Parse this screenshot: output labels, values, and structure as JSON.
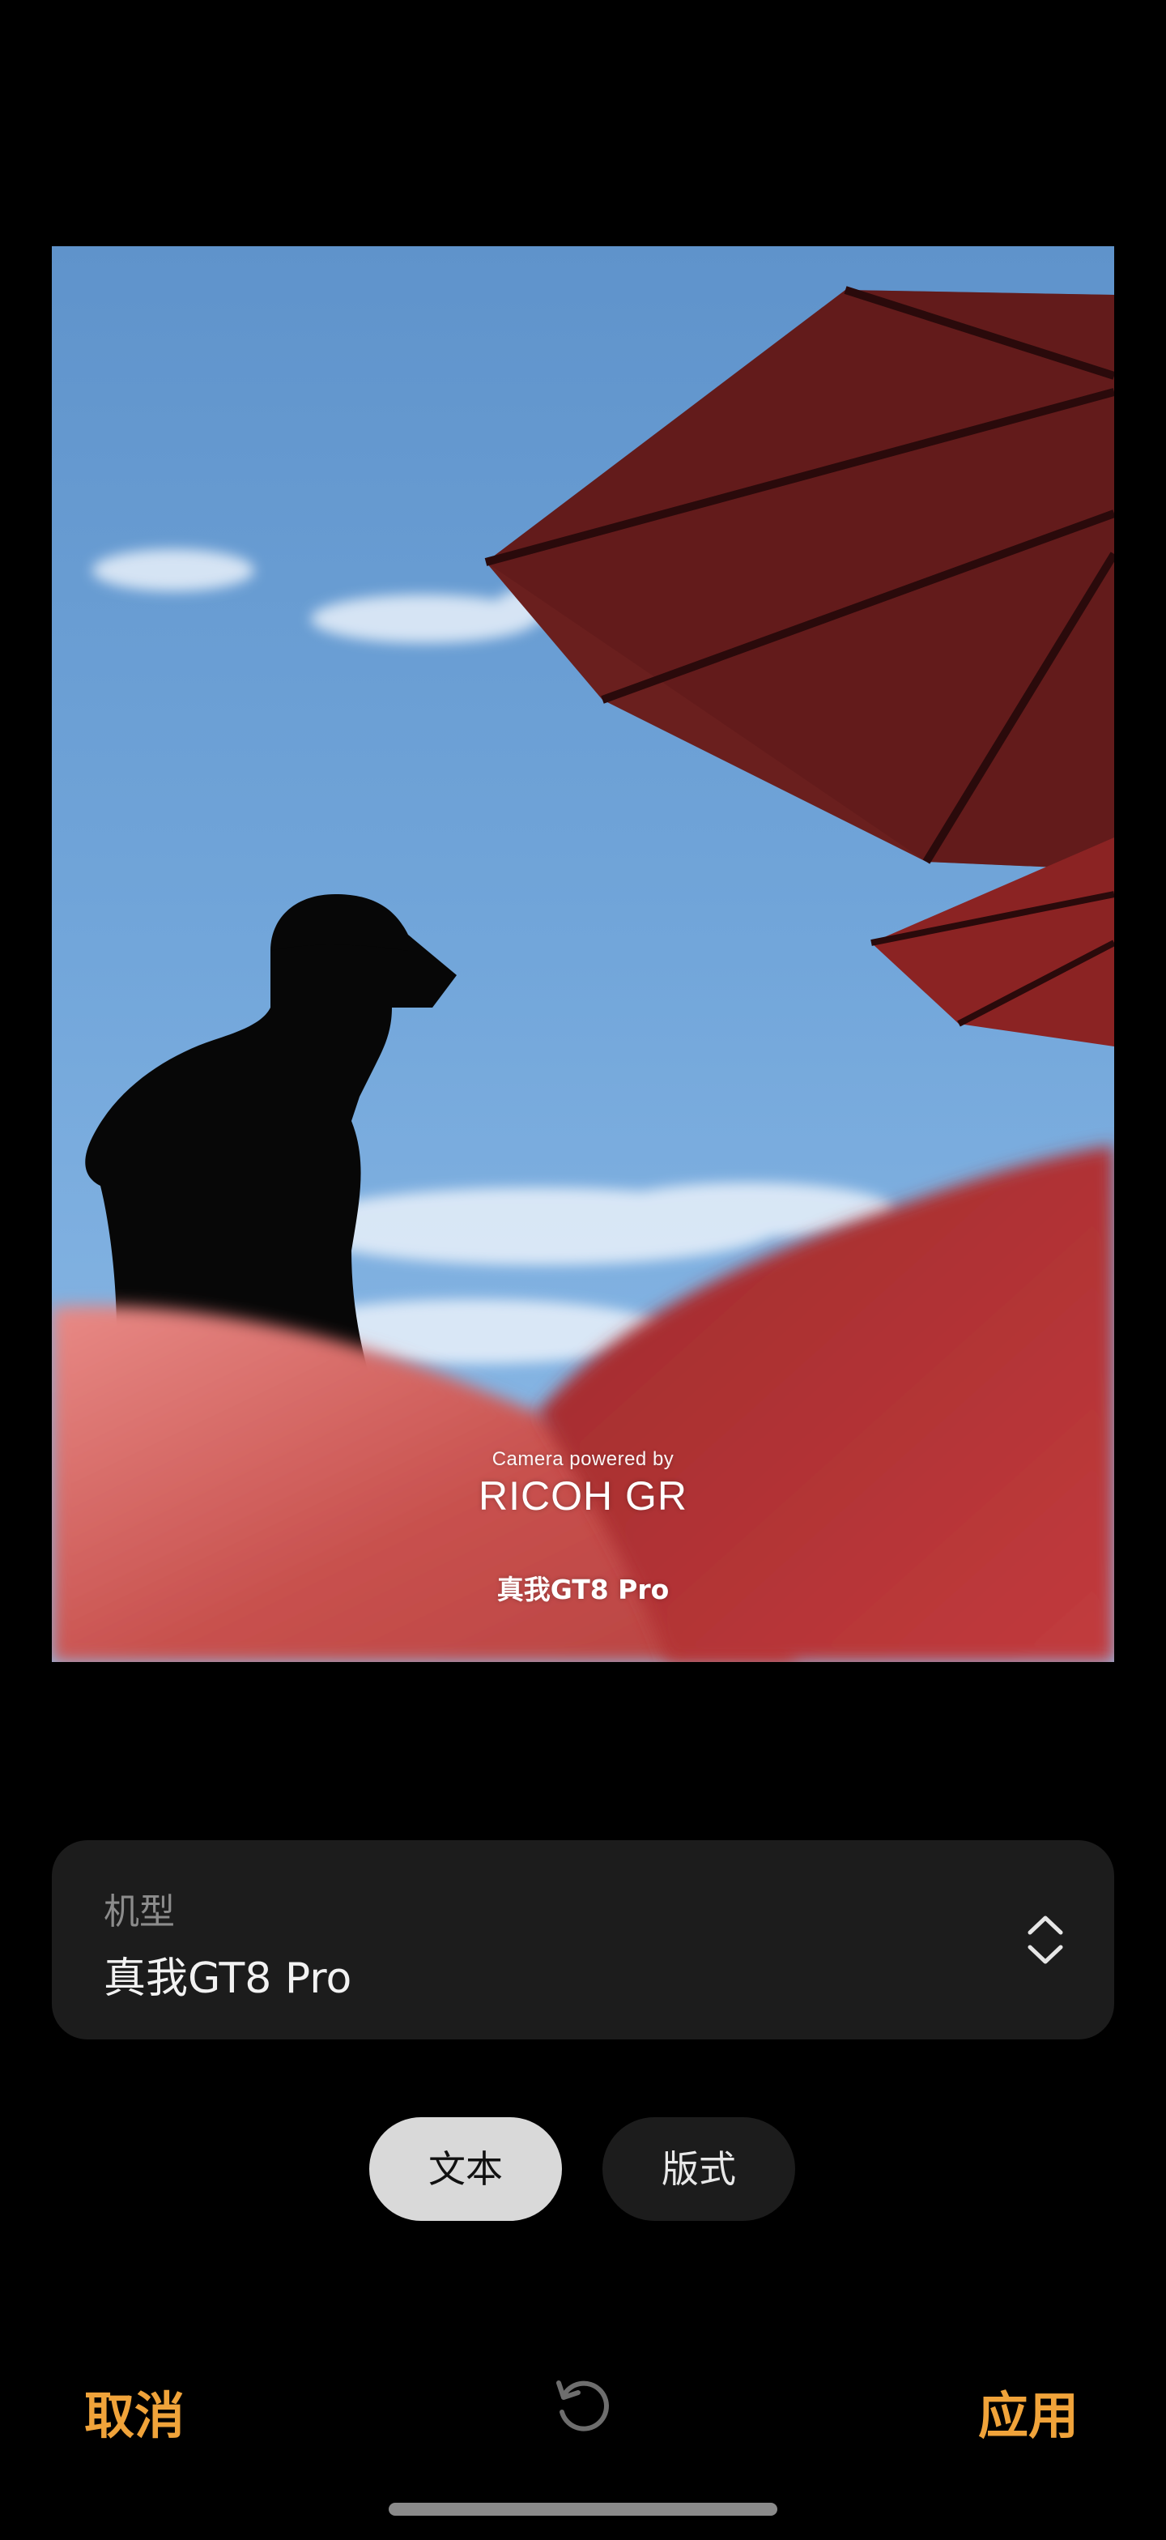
{
  "photo": {
    "watermark": {
      "caption": "Camera powered by",
      "brand": "RICOH GR",
      "model": "真我GT8 Pro"
    }
  },
  "model_field": {
    "label": "机型",
    "value": "真我GT8 Pro",
    "icon": "chevron-up-down-icon"
  },
  "tabs": [
    {
      "label": "文本",
      "selected": true
    },
    {
      "label": "版式",
      "selected": false
    }
  ],
  "actions": {
    "cancel_label": "取消",
    "apply_label": "应用",
    "reset_icon": "reset-icon"
  },
  "colors": {
    "background": "#000000",
    "accent": "#F0A33A",
    "card": "#1C1C1C",
    "tab_selected": "#D9D9D9"
  }
}
